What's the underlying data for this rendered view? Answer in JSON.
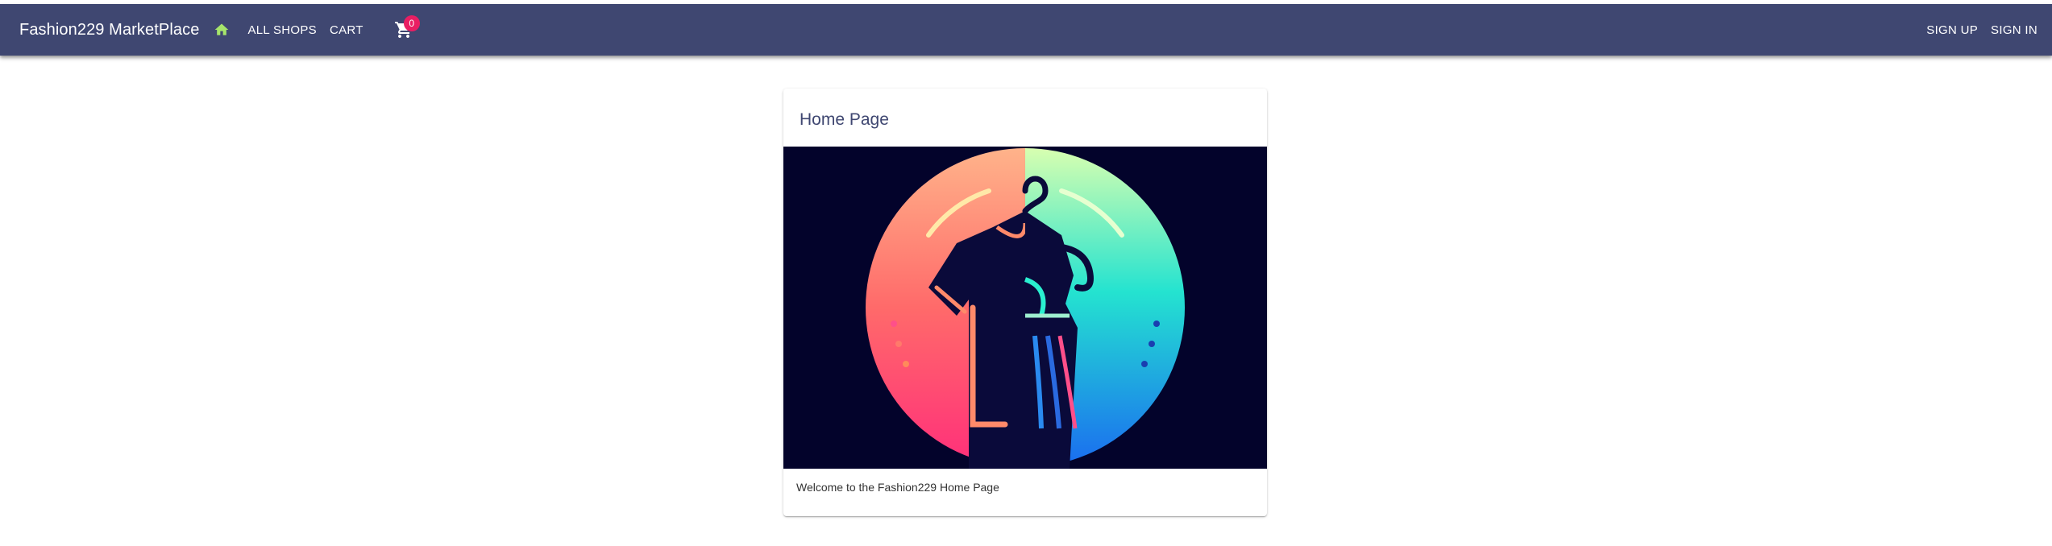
{
  "header": {
    "brand": "Fashion229 MarketPlace",
    "nav": {
      "all_shops": "ALL SHOPS",
      "cart": "CART",
      "cart_count": "0",
      "sign_up": "SIGN UP",
      "sign_in": "SIGN IN"
    },
    "icons": {
      "home": "home-icon",
      "cart": "shopping-cart-icon"
    },
    "colors": {
      "bar": "#3f4771",
      "home_icon": "#a6e56b",
      "badge": "#e91e63"
    }
  },
  "card": {
    "title": "Home Page",
    "image_icon": "fashion-logo-image",
    "body": "Welcome to the Fashion229 Home Page"
  }
}
